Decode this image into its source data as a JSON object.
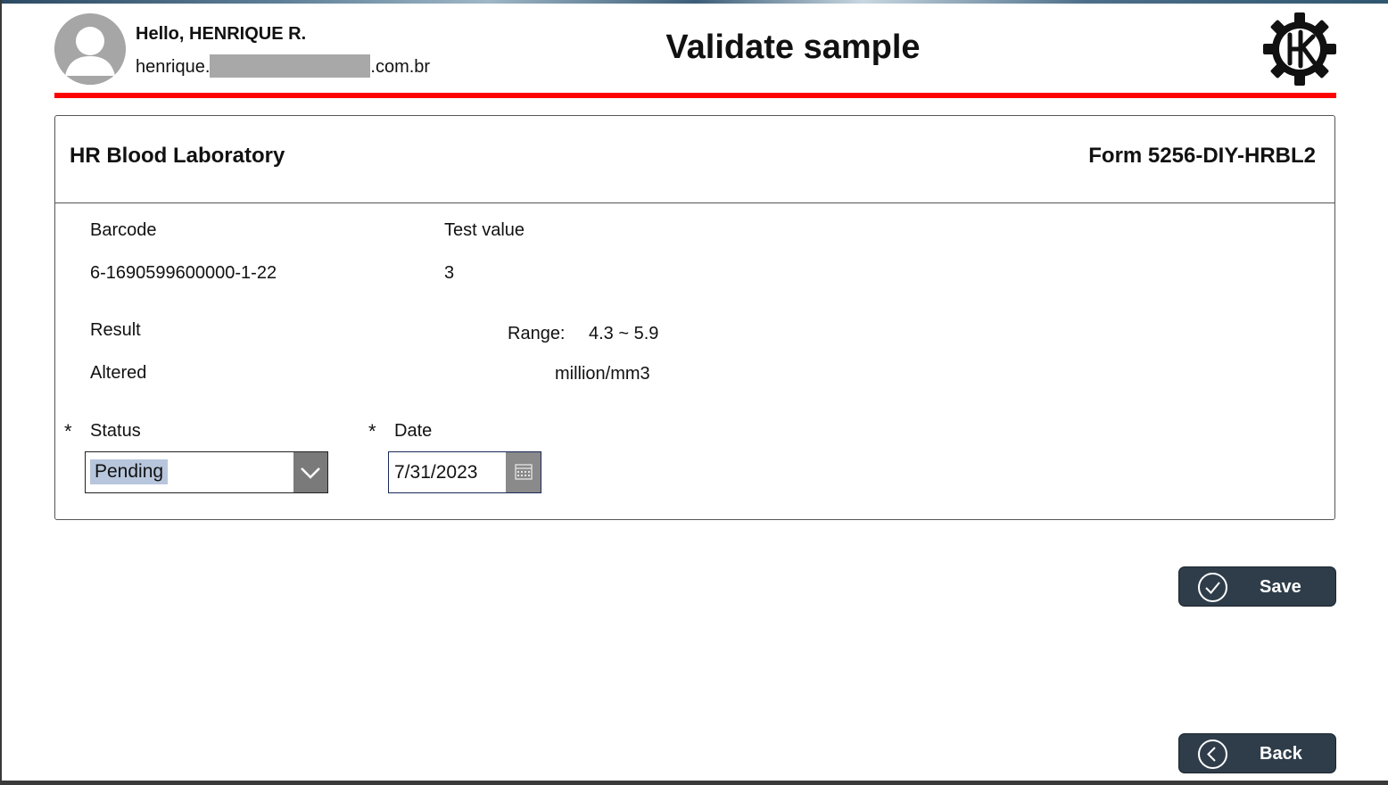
{
  "header": {
    "greeting": "Hello, HENRIQUE R.",
    "email_prefix": "henrique.",
    "email_suffix": ".com.br",
    "title": "Validate sample",
    "accent_color": "#ff0000"
  },
  "card": {
    "lab_name": "HR Blood Laboratory",
    "form_id": "Form 5256-DIY-HRBL2",
    "barcode_label": "Barcode",
    "barcode_value": "6-1690599600000-1-22",
    "test_value_label": "Test value",
    "test_value": "3",
    "result_label": "Result",
    "result_value": "Altered",
    "range_label": "Range:",
    "range_value": "4.3 ~ 5.9",
    "unit": "million/mm3",
    "status_label": "Status",
    "status_required_mark": "*",
    "status_value": "Pending",
    "date_label": "Date",
    "date_required_mark": "*",
    "date_value": "7/31/2023"
  },
  "actions": {
    "save_label": "Save",
    "back_label": "Back",
    "button_color": "#2f3d4a"
  },
  "icons": {
    "avatar": "user-avatar-icon",
    "logo": "gear-hr-logo-icon",
    "dropdown": "chevron-down-icon",
    "calendar": "calendar-icon",
    "save": "check-circle-icon",
    "back": "chevron-left-circle-icon"
  }
}
